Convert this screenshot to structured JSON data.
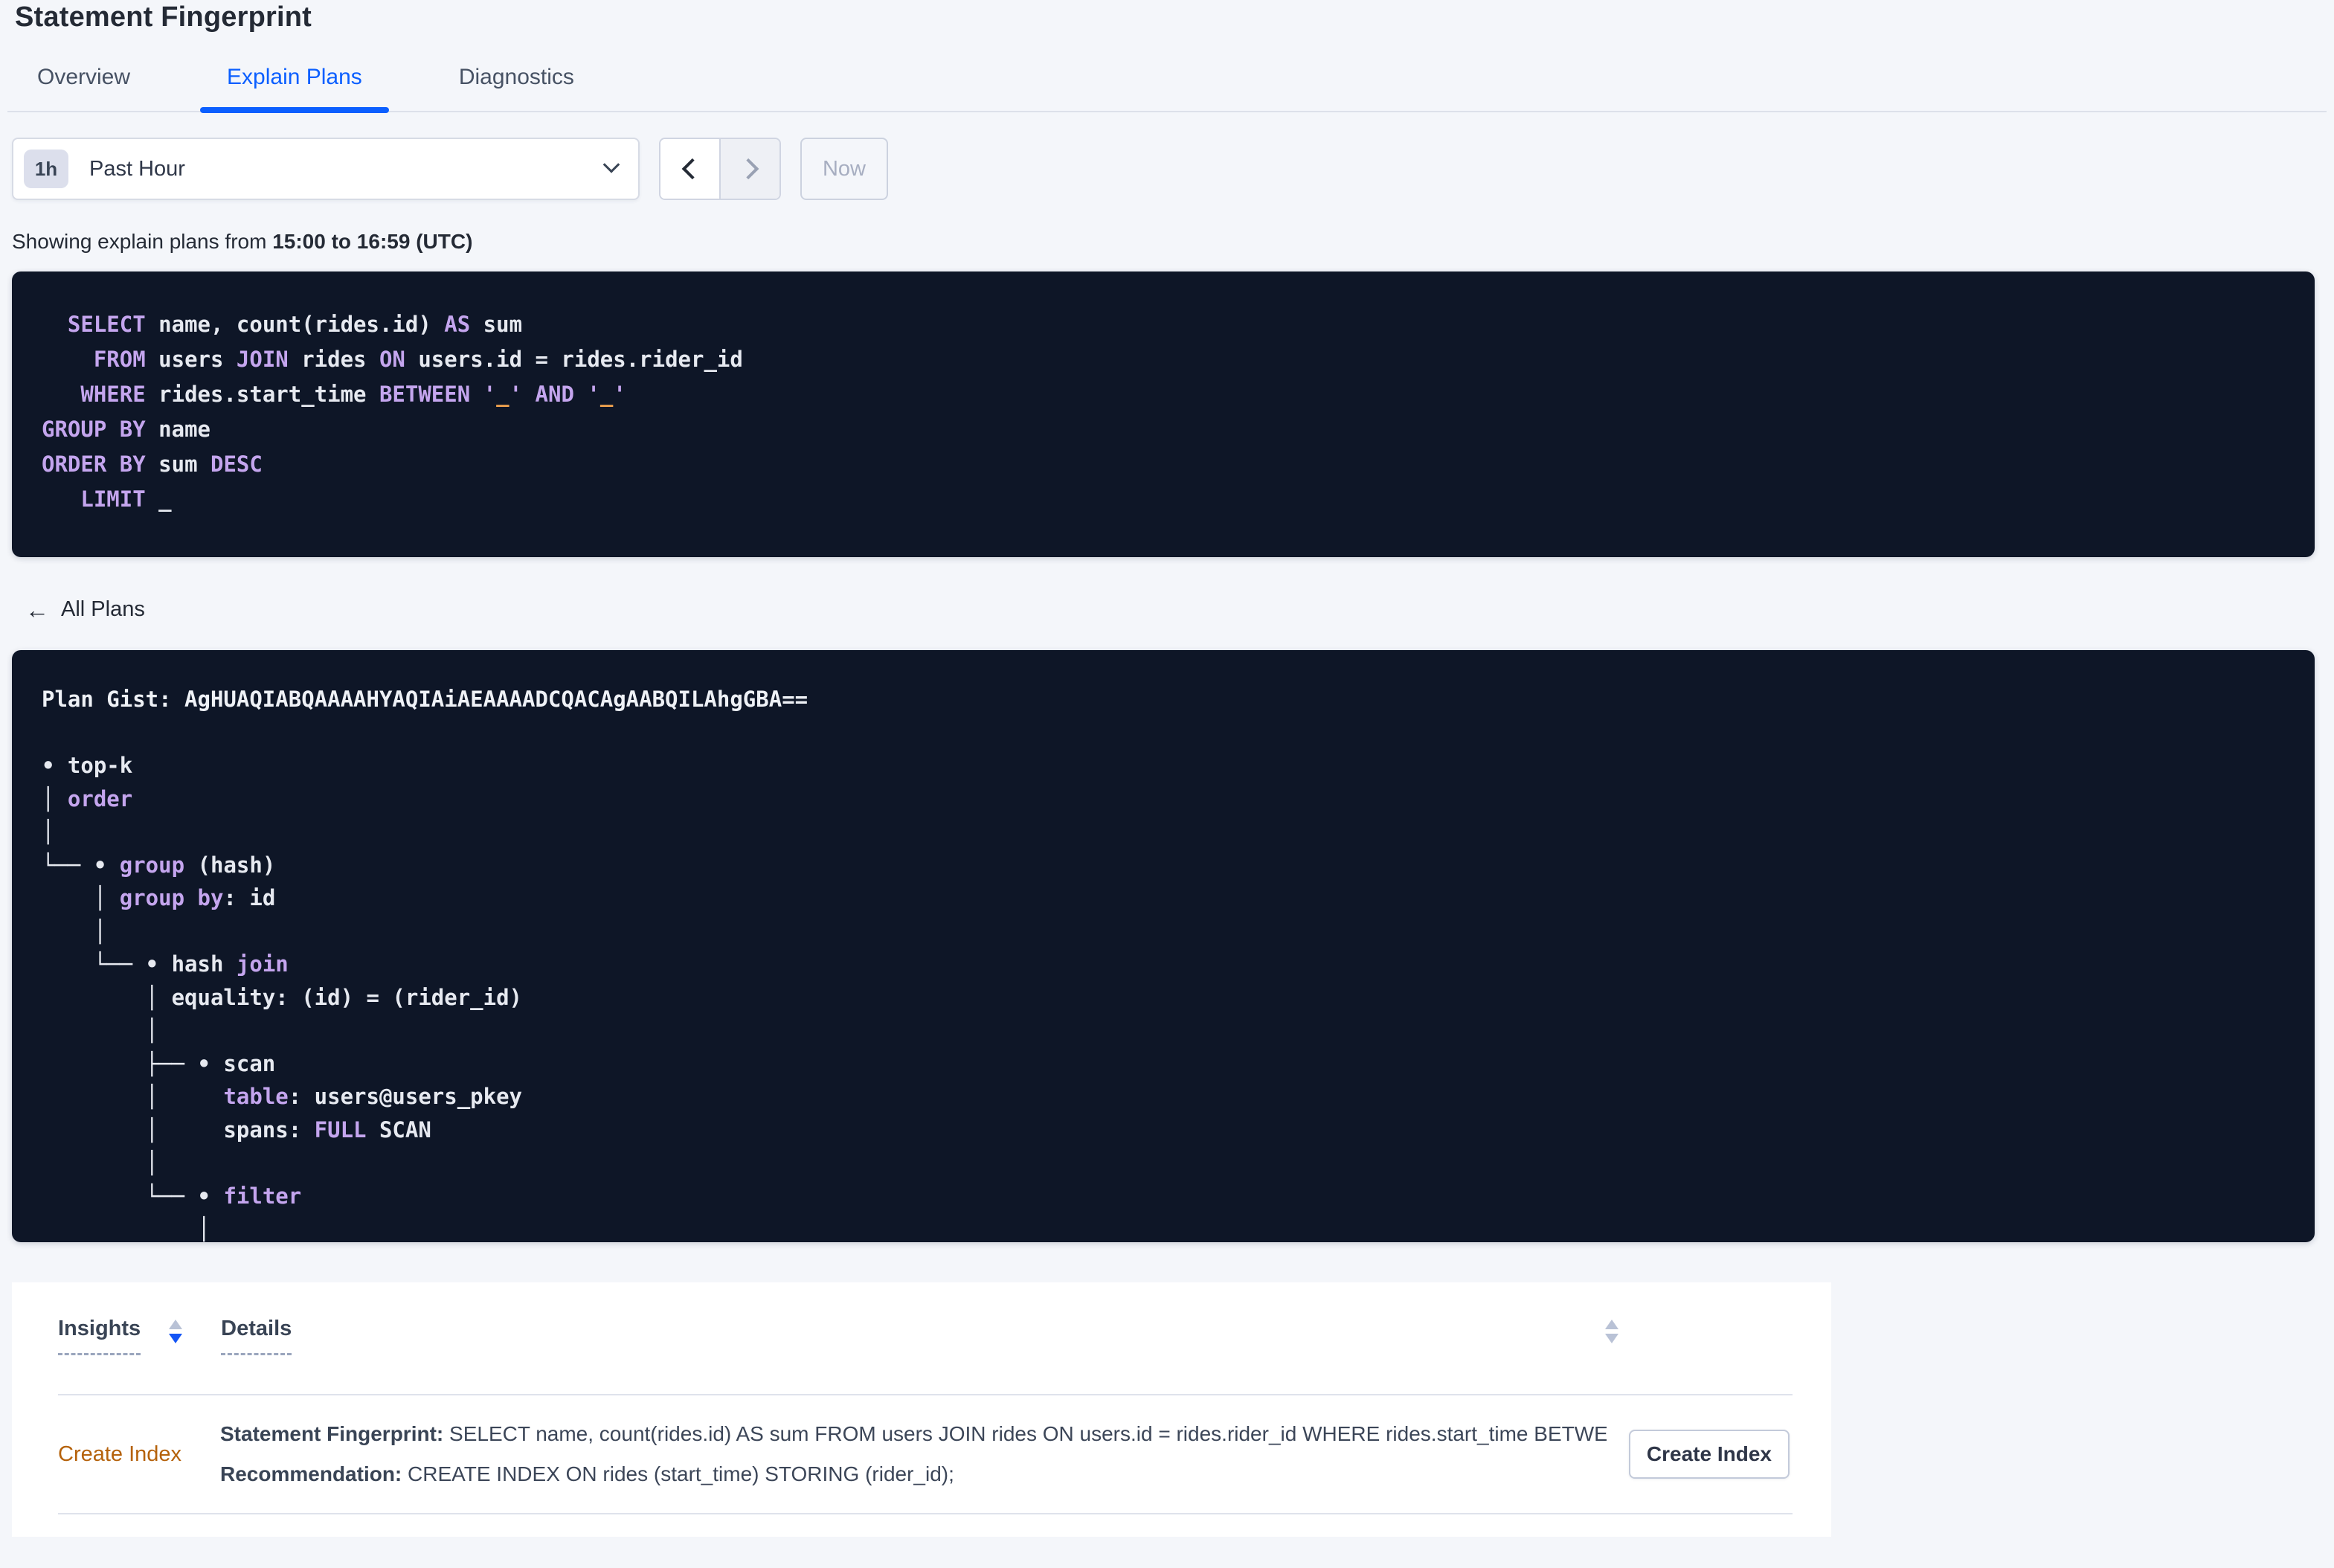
{
  "header": {
    "title": "Statement Fingerprint"
  },
  "tabs": [
    {
      "label": "Overview",
      "active": false
    },
    {
      "label": "Explain Plans",
      "active": true
    },
    {
      "label": "Diagnostics",
      "active": false
    }
  ],
  "time_picker": {
    "badge": "1h",
    "label": "Past Hour",
    "now_label": "Now",
    "prev_icon": "chevron-left",
    "next_icon": "chevron-right",
    "next_disabled": true,
    "now_disabled": true
  },
  "subtitle": {
    "prefix": "Showing explain plans from ",
    "range_bold": "15:00 to 16:59 (UTC)"
  },
  "colors": {
    "accent_blue": "#0b5fff",
    "code_background": "#0e1627",
    "code_keyword": "#c4a5ee",
    "code_text": "#e6e9f0",
    "code_literal": "#f2a44f",
    "insight_link_orange": "#b5620b",
    "sort_active_blue": "#1455f5"
  },
  "sql": {
    "lines": [
      [
        {
          "c": "kw",
          "t": "  SELECT"
        },
        {
          "c": "tx",
          "t": " name, count(rides.id) "
        },
        {
          "c": "kw",
          "t": "AS"
        },
        {
          "c": "tx",
          "t": " sum"
        }
      ],
      [
        {
          "c": "kw",
          "t": "    FROM"
        },
        {
          "c": "tx",
          "t": " users "
        },
        {
          "c": "kw",
          "t": "JOIN"
        },
        {
          "c": "tx",
          "t": " rides "
        },
        {
          "c": "kw",
          "t": "ON"
        },
        {
          "c": "tx",
          "t": " users.id = rides.rider_id"
        }
      ],
      [
        {
          "c": "kw",
          "t": "   WHERE"
        },
        {
          "c": "tx",
          "t": " rides.start_time "
        },
        {
          "c": "kw",
          "t": "BETWEEN"
        },
        {
          "c": "tx",
          "t": " "
        },
        {
          "c": "kw",
          "t": "'"
        },
        {
          "c": "lit",
          "t": "_"
        },
        {
          "c": "kw",
          "t": "'"
        },
        {
          "c": "tx",
          "t": " "
        },
        {
          "c": "kw",
          "t": "AND"
        },
        {
          "c": "tx",
          "t": " "
        },
        {
          "c": "kw",
          "t": "'"
        },
        {
          "c": "lit",
          "t": "_"
        },
        {
          "c": "kw",
          "t": "'"
        }
      ],
      [
        {
          "c": "kw",
          "t": "GROUP BY"
        },
        {
          "c": "tx",
          "t": " name"
        }
      ],
      [
        {
          "c": "kw",
          "t": "ORDER BY"
        },
        {
          "c": "tx",
          "t": " sum "
        },
        {
          "c": "kw",
          "t": "DESC"
        }
      ],
      [
        {
          "c": "kw",
          "t": "   LIMIT"
        },
        {
          "c": "tx",
          "t": " _"
        }
      ]
    ]
  },
  "all_plans": {
    "label": "All Plans",
    "back_icon": "left-arrow"
  },
  "plan": {
    "gist": "AgHUAQIABQAAAAHYAQIAiAEAAAADCQACAgAABQILAhgGBA==",
    "lines": [
      [
        {
          "c": "b",
          "t": "Plan Gist: AgHUAQIABQAAAAHYAQIAiAEAAAADCQACAgAABQILAhgGBA=="
        }
      ],
      [],
      [
        {
          "c": "tx",
          "t": "• top-k"
        }
      ],
      [
        {
          "c": "tx",
          "t": "│ "
        },
        {
          "c": "kw",
          "t": "order"
        }
      ],
      [
        {
          "c": "tx",
          "t": "│"
        }
      ],
      [
        {
          "c": "tx",
          "t": "└── • "
        },
        {
          "c": "kw",
          "t": "group"
        },
        {
          "c": "tx",
          "t": " (hash)"
        }
      ],
      [
        {
          "c": "tx",
          "t": "    │ "
        },
        {
          "c": "kw",
          "t": "group by"
        },
        {
          "c": "tx",
          "t": ": id"
        }
      ],
      [
        {
          "c": "tx",
          "t": "    │"
        }
      ],
      [
        {
          "c": "tx",
          "t": "    └── • hash "
        },
        {
          "c": "kw",
          "t": "join"
        }
      ],
      [
        {
          "c": "tx",
          "t": "        │ equality: (id) = (rider_id)"
        }
      ],
      [
        {
          "c": "tx",
          "t": "        │"
        }
      ],
      [
        {
          "c": "tx",
          "t": "        ├── • scan"
        }
      ],
      [
        {
          "c": "tx",
          "t": "        │     "
        },
        {
          "c": "kw",
          "t": "table"
        },
        {
          "c": "tx",
          "t": ": users@users_pkey"
        }
      ],
      [
        {
          "c": "tx",
          "t": "        │     spans: "
        },
        {
          "c": "kw",
          "t": "FULL"
        },
        {
          "c": "tx",
          "t": " SCAN"
        }
      ],
      [
        {
          "c": "tx",
          "t": "        │"
        }
      ],
      [
        {
          "c": "tx",
          "t": "        └── • "
        },
        {
          "c": "kw",
          "t": "filter"
        }
      ],
      [
        {
          "c": "tx",
          "t": "            │"
        }
      ]
    ]
  },
  "insights_table": {
    "headers": [
      {
        "label": "Insights",
        "sortable": true,
        "sort_direction": "desc"
      },
      {
        "label": "Details",
        "sortable": true,
        "sort_direction": "none"
      }
    ],
    "row": {
      "insight": "Create Index",
      "details": [
        {
          "label": "Statement Fingerprint:",
          "text": " SELECT name, count(rides.id) AS sum FROM users JOIN rides ON users.id = rides.rider_id WHERE rides.start_time BETWEEN '_…"
        },
        {
          "label": "Recommendation:",
          "text": " CREATE INDEX ON rides (start_time) STORING (rider_id);"
        }
      ],
      "action_label": "Create Index"
    }
  }
}
